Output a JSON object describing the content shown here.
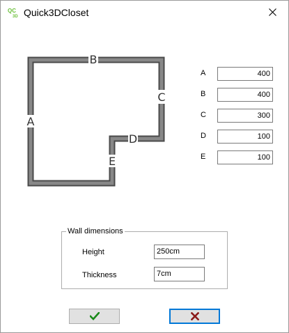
{
  "window": {
    "title": "Quick3DCloset",
    "icon": "qc-3d-app-icon",
    "close_icon": "close-icon"
  },
  "diagram": {
    "wall_labels": [
      "A",
      "B",
      "C",
      "D",
      "E"
    ]
  },
  "dimensions": [
    {
      "label": "A",
      "value": "400"
    },
    {
      "label": "B",
      "value": "400"
    },
    {
      "label": "C",
      "value": "300"
    },
    {
      "label": "D",
      "value": "100"
    },
    {
      "label": "E",
      "value": "100"
    }
  ],
  "wall_dimensions": {
    "legend": "Wall dimensions",
    "height_label": "Height",
    "height_value": "250cm",
    "thickness_label": "Thickness",
    "thickness_value": "7cm"
  },
  "buttons": {
    "ok_icon": "checkmark-icon",
    "cancel_icon": "x-icon"
  },
  "colors": {
    "wall_fill": "#888888",
    "ok_green": "#1a8a1a",
    "cancel_red": "#8b1a1a",
    "focus_blue": "#0078d7"
  }
}
